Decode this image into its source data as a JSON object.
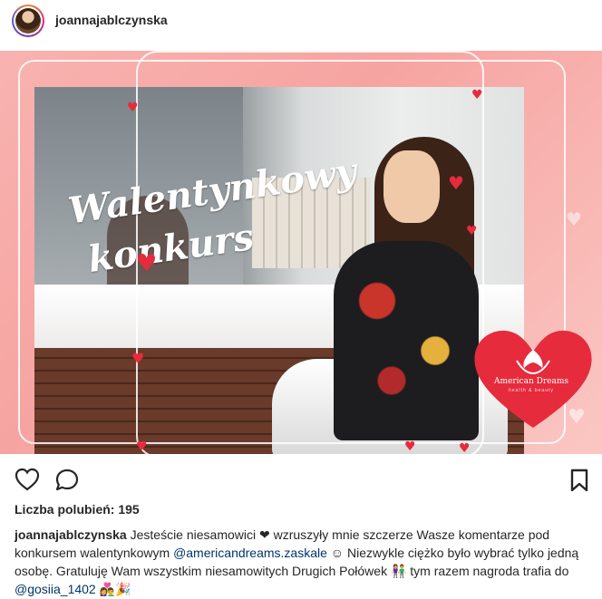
{
  "post": {
    "username": "joannajablczynska",
    "image_title_line1": "Walentynkowy",
    "image_title_line2": "konkurs",
    "logo_brand": "American Dreams",
    "logo_sub": "health & beauty",
    "likes_label": "Liczba polubień: 195",
    "caption": {
      "user": "joannajablczynska",
      "text1": " Jesteście niesamowici ",
      "heart_emoji": "❤",
      "text2": " wzruszyły mnie szczerze Wasze komentarze pod konkursem walentynkowym ",
      "mention1": "@americandreams.zaskale",
      "smile_emoji": " ☺",
      "text3": " Niezwykle ciężko było wybrać tylko jedną osobę. Gratuluję Wam wszystkim niesamowitych Drugich Połówek ",
      "couple_emoji": "👫",
      "text4": " tym razem nagroda trafia do ",
      "mention2": "@gosiia_1402",
      "gift_emoji": " 👩‍❤️‍👨🎉"
    }
  },
  "icons": {
    "like": "heart-outline-icon",
    "comment": "speech-bubble-icon",
    "save": "bookmark-icon"
  },
  "colors": {
    "heart_red": "#e62b3d",
    "background_pink": "#f6a4a1",
    "mention_blue": "#003569"
  }
}
